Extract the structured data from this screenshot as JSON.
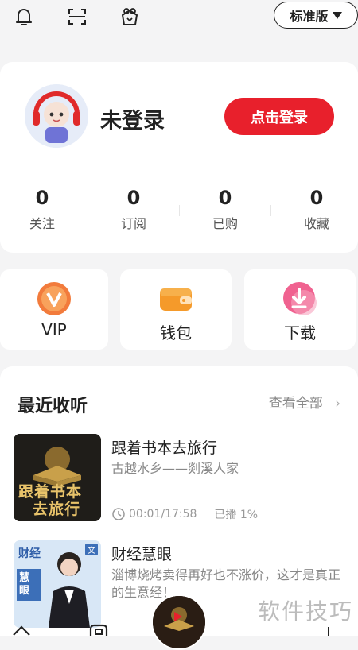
{
  "header": {
    "edition_label": "标准版"
  },
  "profile": {
    "username": "未登录",
    "login_button": "点击登录",
    "stats": [
      {
        "value": "0",
        "label": "关注"
      },
      {
        "value": "0",
        "label": "订阅"
      },
      {
        "value": "0",
        "label": "已购"
      },
      {
        "value": "0",
        "label": "收藏"
      }
    ]
  },
  "quick_cards": [
    {
      "label": "VIP",
      "icon": "vip-icon"
    },
    {
      "label": "钱包",
      "icon": "wallet-icon"
    },
    {
      "label": "下载",
      "icon": "download-icon"
    }
  ],
  "recent": {
    "title": "最近收听",
    "view_all": "查看全部",
    "items": [
      {
        "title": "跟着书本去旅行",
        "subtitle": "古越水乡——剡溪人家",
        "cover_text_1": "跟着书本",
        "cover_text_2": "去旅行",
        "time": "00:01/17:58",
        "played": "已播 1%"
      },
      {
        "title": "财经慧眼",
        "subtitle": "淄博烧烤卖得再好也不涨价，这才是真正的生意经！",
        "cover_text_1": "财经",
        "cover_text_2": "慧眼",
        "cover_badge": "文"
      }
    ]
  },
  "watermark": "软件技巧",
  "colors": {
    "accent": "#e8202c",
    "background": "#f4f4f5"
  }
}
